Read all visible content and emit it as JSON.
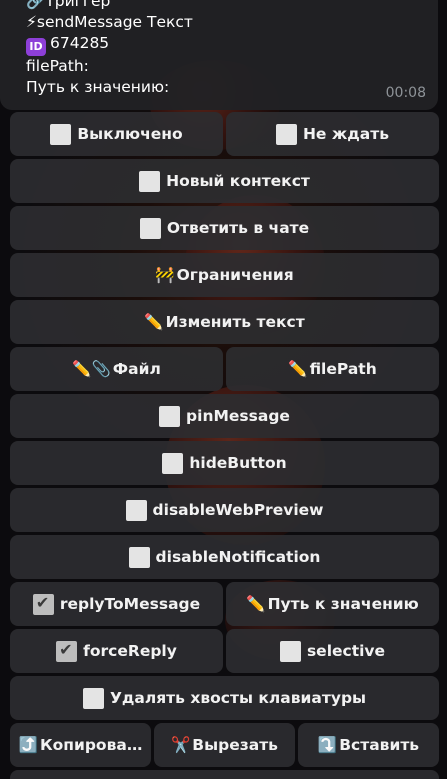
{
  "message": {
    "trigger": "🔗Триггер",
    "send": "⚡sendMessage Текст",
    "id_badge": "ID",
    "id_value": "674285",
    "filepath": "filePath:",
    "value_path": "Путь к значению:",
    "time": "00:08"
  },
  "keyboard": {
    "off": "Выключено",
    "no_wait": "Не ждать",
    "new_context": "Новый контекст",
    "reply_chat": "Ответить в чате",
    "limits_emoji": "🚧",
    "limits": "Ограничения",
    "edit_emoji": "✏️",
    "edit_text": "Изменить текст",
    "file_emoji": "✏️📎",
    "file": "Файл",
    "filepath_emoji": "✏️",
    "filepath": "filePath",
    "pin": "pinMessage",
    "hide": "hideButton",
    "disable_preview": "disableWebPreview",
    "disable_notif": "disableNotification",
    "reply_to": "replyToMessage",
    "value_path_emoji": "✏️",
    "value_path": "Путь к значению",
    "force_reply": "forceReply",
    "selective": "selective",
    "delete_tails": "Удалять хвосты клавиатуры",
    "copy_emoji": "⤴️",
    "copy": "Копирова…",
    "cut_emoji": "✂️",
    "cut": "Вырезать",
    "paste_emoji": "⤵️",
    "paste": "Вставить"
  }
}
